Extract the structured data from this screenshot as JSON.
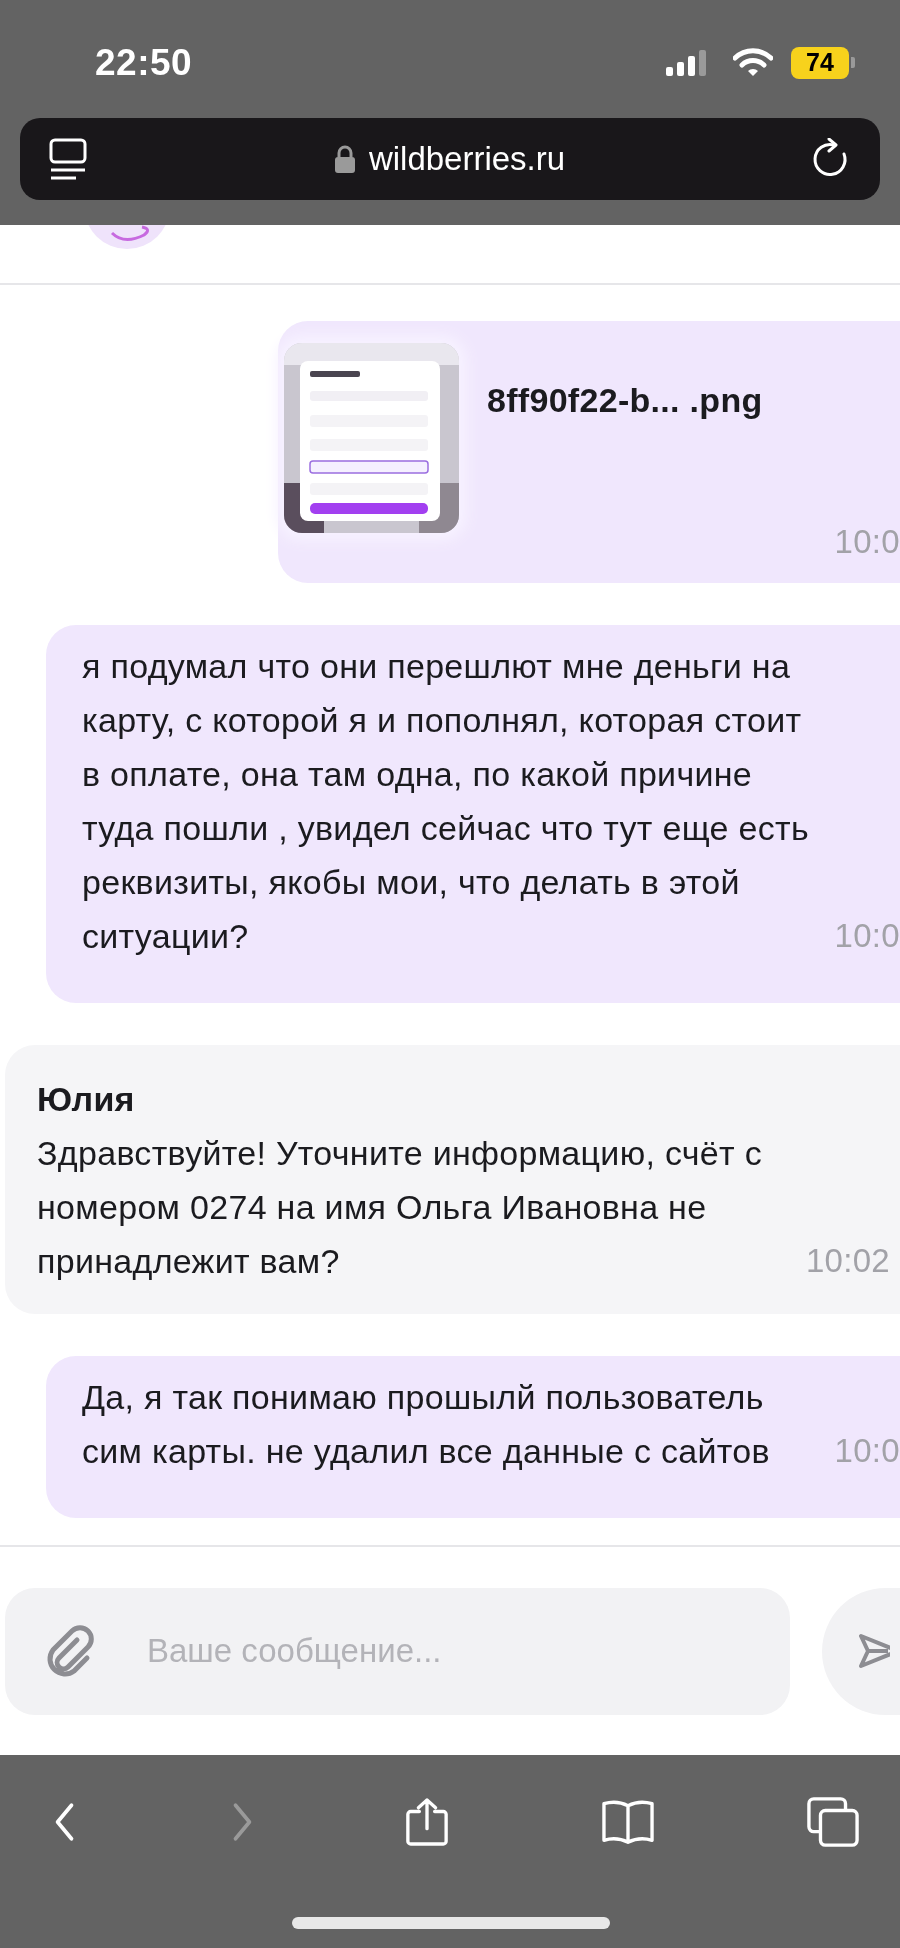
{
  "status_bar": {
    "time": "22:50",
    "battery": "74"
  },
  "browser": {
    "url": "wildberries.ru"
  },
  "messages": [
    {
      "kind": "file",
      "file_name": "8ff90f22-b... .png",
      "time": "10:0"
    },
    {
      "kind": "sent",
      "text": "я подумал что они перешлют мне деньги на карту, с которой я и пополнял, которая стоит в оплате, она там одна, по какой причине туда пошли , увидел сейчас что тут еще есть реквизиты, якобы мои, что делать в этой ситуации?",
      "time": "10:0"
    },
    {
      "kind": "received",
      "author": "Юлия",
      "text": "Здравствуйте! Уточните информацию, счёт с номером 0274 на имя Ольга Ивановна не принадлежит вам?",
      "time": "10:02"
    },
    {
      "kind": "sent",
      "text": "Да, я так понимаю прошылй пользователь сим карты. не удалил все данные с сайтов",
      "time": "10:0"
    }
  ],
  "composer": {
    "placeholder": "Ваше сообщение..."
  },
  "toolbar": [
    {
      "kind": "back",
      "disabled": false
    },
    {
      "kind": "forward",
      "disabled": true
    },
    {
      "kind": "share",
      "disabled": false
    },
    {
      "kind": "bookmarks",
      "disabled": false
    },
    {
      "kind": "tabs",
      "disabled": false
    }
  ]
}
